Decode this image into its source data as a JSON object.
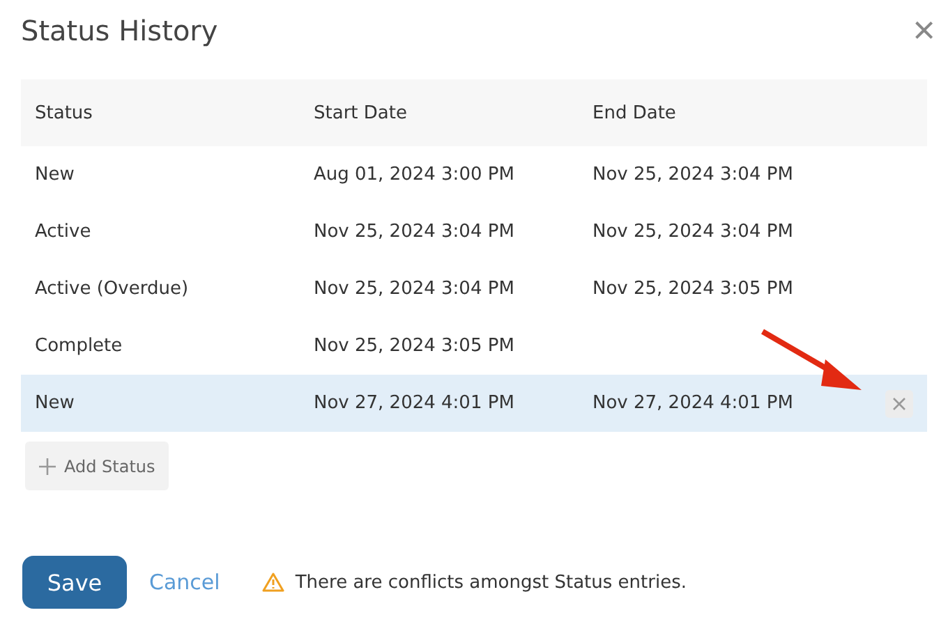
{
  "dialog": {
    "title": "Status History",
    "close": "×"
  },
  "table": {
    "columns": [
      "Status",
      "Start Date",
      "End Date"
    ],
    "rows": [
      {
        "cells": [
          "New",
          "Aug 01, 2024 3:00 PM",
          "Nov 25, 2024 3:04 PM"
        ],
        "selected": false
      },
      {
        "cells": [
          "Active",
          "Nov 25, 2024 3:04 PM",
          "Nov 25, 2024 3:04 PM"
        ],
        "selected": false
      },
      {
        "cells": [
          "Active (Overdue)",
          "Nov 25, 2024 3:04 PM",
          "Nov 25, 2024 3:05 PM"
        ],
        "selected": false
      },
      {
        "cells": [
          "Complete",
          "Nov 25, 2024 3:05 PM",
          ""
        ],
        "selected": false
      },
      {
        "cells": [
          "New",
          "Nov 27, 2024 4:01 PM",
          "Nov 27, 2024 4:01 PM"
        ],
        "selected": true
      }
    ]
  },
  "add_button": {
    "label": "Add Status"
  },
  "footer": {
    "save": "Save",
    "cancel": "Cancel",
    "warning": "There are conflicts amongst Status entries."
  }
}
